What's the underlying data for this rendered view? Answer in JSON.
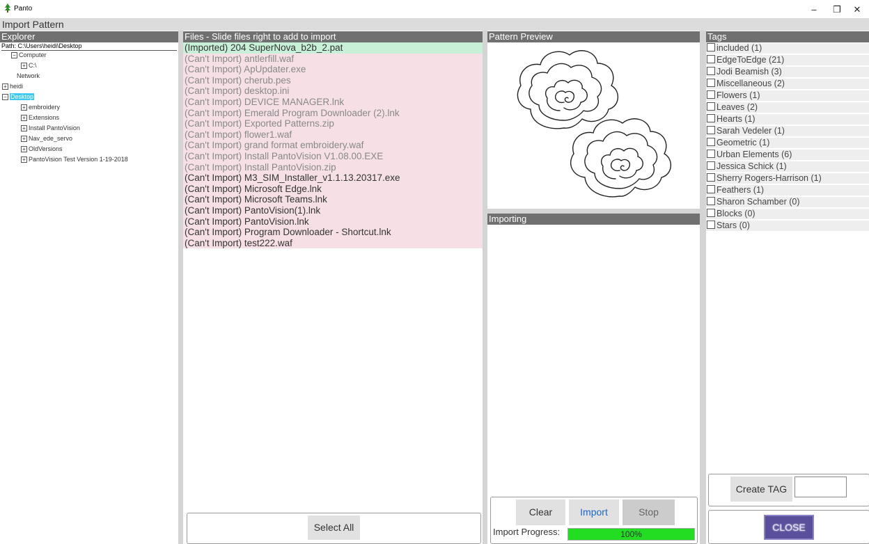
{
  "app": {
    "title": "Panto"
  },
  "window": {
    "title": "Import Pattern"
  },
  "explorer": {
    "header": "Explorer",
    "path": "Path: C:\\Users\\heidi\\Desktop",
    "tree": [
      {
        "label": "Computer",
        "toggle": "−",
        "selected": false
      },
      {
        "label": "C:\\",
        "toggle": "+",
        "selected": false
      },
      {
        "label": "Network",
        "toggle": "",
        "selected": false
      },
      {
        "label": "heidi",
        "toggle": "+",
        "selected": false
      },
      {
        "label": "Desktop",
        "toggle": "−",
        "selected": true
      },
      {
        "label": "embroidery",
        "toggle": "+",
        "selected": false
      },
      {
        "label": "Extensions",
        "toggle": "+",
        "selected": false
      },
      {
        "label": "Install PantoVision",
        "toggle": "+",
        "selected": false
      },
      {
        "label": "Nav_ede_servo",
        "toggle": "+",
        "selected": false
      },
      {
        "label": "OldVersions",
        "toggle": "+",
        "selected": false
      },
      {
        "label": "PantoVision Test Version 1-19-2018",
        "toggle": "+",
        "selected": false
      }
    ]
  },
  "files": {
    "header": "Files - Slide files right to add to import",
    "items": [
      "(Imported) 204 SuperNova_b2b_2.pat",
      "(Can't Import) antlerfill.waf",
      "(Can't Import) ApUpdater.exe",
      "(Can't Import) cherub.pes",
      "(Can't Import) desktop.ini",
      "(Can't Import) DEVICE MANAGER.lnk",
      "(Can't Import) Emerald Program Downloader (2).lnk",
      "(Can't Import) Exported Patterns.zip",
      "(Can't Import) flower1.waf",
      "(Can't Import) grand format embroidery.waf",
      "(Can't Import) Install PantoVision V1.08.00.EXE",
      "(Can't Import) Install PantoVision.zip",
      "(Can't Import) M3_SIM_Installer_v1.1.13.20317.exe",
      "(Can't Import) Microsoft Edge.lnk",
      "(Can't Import) Microsoft Teams.lnk",
      "(Can't Import) PantoVision(1).lnk",
      "(Can't Import) PantoVision.lnk",
      "(Can't Import) Program Downloader - Shortcut.lnk",
      "(Can't Import) test222.waf"
    ],
    "select_all": "Select All"
  },
  "preview": {
    "header": "Pattern Preview"
  },
  "importing": {
    "header": "Importing",
    "clear": "Clear",
    "import": "Import",
    "stop": "Stop",
    "progress_label": "Import Progress:",
    "progress_text": "100%",
    "progress_value": 1.0
  },
  "tags": {
    "header": "Tags",
    "items": [
      "included (1)",
      "EdgeToEdge (21)",
      "Jodi Beamish (3)",
      "Miscellaneous (2)",
      "Flowers (1)",
      "Leaves (2)",
      "Hearts (1)",
      "Sarah Vedeler (1)",
      "Geometric (1)",
      "Urban Elements (6)",
      "Jessica Schick (1)",
      "Sherry Rogers-Harrison (1)",
      "Feathers (1)",
      "Sharon Schamber (0)",
      "Blocks (0)",
      "Stars (0)"
    ],
    "create_tag": "Create TAG",
    "close": "CLOSE"
  },
  "colors": {
    "imported_row": "#c8f0d8",
    "blocked_row": "#f6e0e6",
    "panel_header": "#707070",
    "progress_fill": "#22dd22",
    "selection": "#3fc8f0",
    "import_text": "#1a66cc",
    "close_button": "#5a4f9a"
  },
  "icons": {
    "app": "tree-icon",
    "minimize": "minimize-icon",
    "maximize": "maximize-icon",
    "close": "close-icon"
  }
}
